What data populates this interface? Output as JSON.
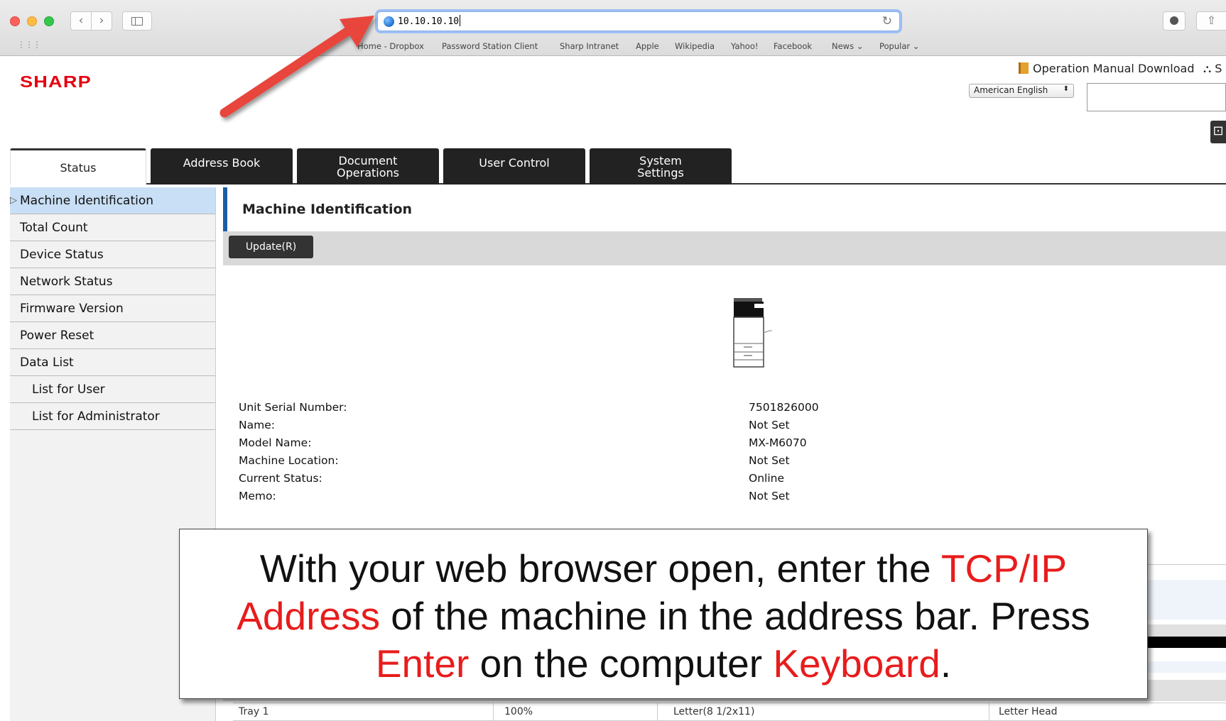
{
  "browser": {
    "address": "10.10.10.10",
    "bookmarks": [
      "Home - Dropbox",
      "Password Station Client",
      "Sharp Intranet",
      "Apple",
      "Wikipedia",
      "Yahoo!",
      "Facebook",
      "News ⌄",
      "Popular ⌄"
    ],
    "icons": {
      "back": "chevron-left-icon",
      "forward": "chevron-right-icon",
      "sidebar": "sidebar-icon",
      "reload": "reload-icon",
      "share": "share-icon",
      "downloads": "downloads-icon",
      "site": "globe-icon"
    }
  },
  "header": {
    "logo": "SHARP",
    "manual_link": "Operation Manual Download",
    "sitemap_link": "S",
    "language": "American English",
    "brand_color": "#e60012"
  },
  "tabs": [
    {
      "label": "Status"
    },
    {
      "label": "Address Book"
    },
    {
      "label": "Document\nOperations"
    },
    {
      "label": "User Control"
    },
    {
      "label": "System\nSettings"
    }
  ],
  "menu": [
    {
      "label": "Machine Identification"
    },
    {
      "label": "Total Count"
    },
    {
      "label": "Device Status"
    },
    {
      "label": "Network Status"
    },
    {
      "label": "Firmware Version"
    },
    {
      "label": "Power Reset"
    },
    {
      "label": "Data List"
    },
    {
      "label": "List for User"
    },
    {
      "label": "List for Administrator"
    }
  ],
  "content": {
    "title": "Machine Identification",
    "update_button": "Update(R)",
    "fields": [
      {
        "label": "Unit Serial Number:",
        "value": "7501826000"
      },
      {
        "label": "Name:",
        "value": "Not Set"
      },
      {
        "label": "Model Name:",
        "value": "MX-M6070"
      },
      {
        "label": "Machine Location:",
        "value": "Not Set"
      },
      {
        "label": "Current Status:",
        "value": "Online"
      },
      {
        "label": "Memo:",
        "value": "Not Set"
      }
    ],
    "tray_row": [
      "Tray 1",
      "100%",
      "Letter(8 1/2x11)",
      "Letter Head"
    ]
  },
  "instruction": {
    "line1_a": "With your web browser open, enter the ",
    "line1_b": "TCP/IP",
    "line2_a": "Address",
    "line2_b": " of the machine in the address bar. Press",
    "line3_a": "Enter",
    "line3_b": " on the computer ",
    "line3_c": "Keyboard",
    "line3_d": ".",
    "highlight_color": "#e81c1c"
  }
}
